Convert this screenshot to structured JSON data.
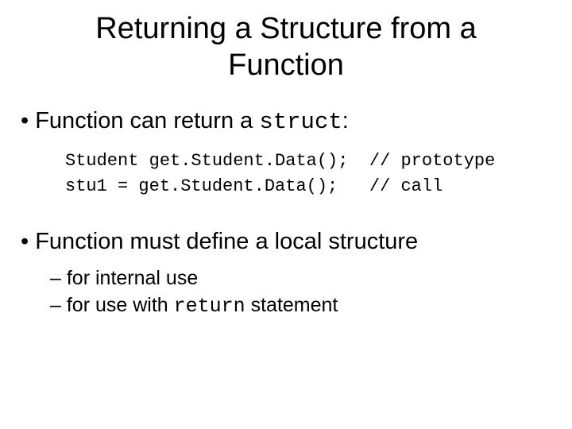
{
  "title_line1": "Returning a Structure from a",
  "title_line2": "Function",
  "bullet1_pre": "Function can return a ",
  "bullet1_code": "struct",
  "bullet1_post": ":",
  "code_line1a": "Student get.Student.Data();",
  "code_line1b": "// prototype",
  "code_line2a": "stu1 = get.Student.Data();",
  "code_line2b": "// call",
  "bullet2": "Function must define a local structure",
  "sub1": "for internal use",
  "sub2_pre": "for use with ",
  "sub2_code": "return",
  "sub2_post": " statement"
}
